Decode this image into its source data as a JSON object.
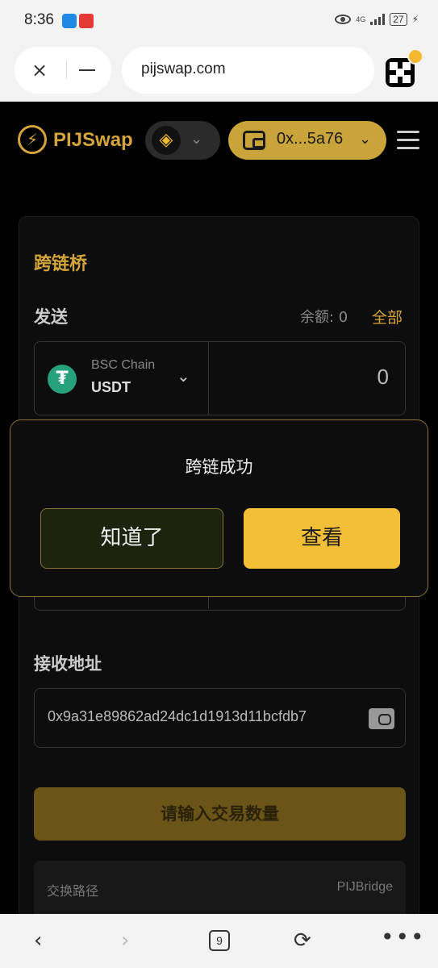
{
  "status_bar": {
    "time": "8:36",
    "network": "4G",
    "battery": "27"
  },
  "browser": {
    "url": "pijswap.com",
    "tab_count": "9"
  },
  "header": {
    "logo_text": "PIJSwap",
    "wallet_address": "0x...5a76"
  },
  "bridge": {
    "title": "跨链桥",
    "send_label": "发送",
    "balance_label": "余额: 0",
    "all_label": "全部",
    "from_chain": "BSC Chain",
    "token": "USDT",
    "amount": "0",
    "receive_label": "接收地址",
    "receive_address": "0x9a31e89862ad24dc1d1913d11bcfdb7",
    "submit_label": "请输入交易数量",
    "route_label": "交换路径",
    "route_value": "PIJBridge"
  },
  "modal": {
    "title": "跨链成功",
    "ok_label": "知道了",
    "view_label": "查看"
  },
  "colors": {
    "accent": "#d4a53a",
    "button_yellow": "#f2bf36",
    "background": "#000000"
  }
}
